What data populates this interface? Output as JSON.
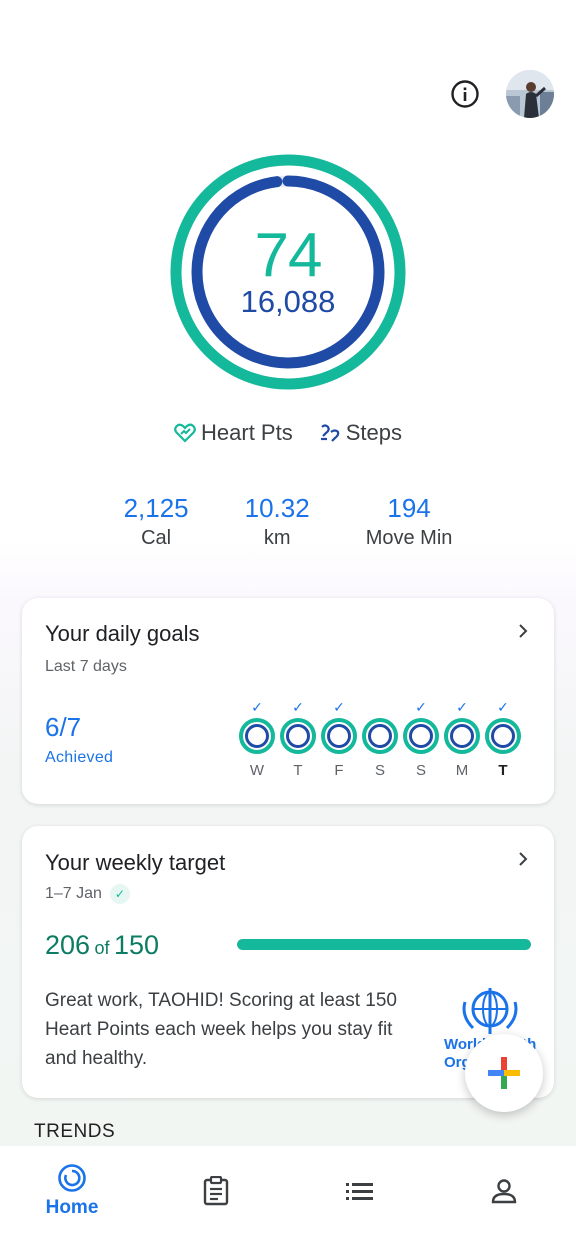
{
  "colors": {
    "heart_points": "#14b89a",
    "steps": "#1f4ba6",
    "accent": "#1a73e8"
  },
  "icons": {
    "info": "info-icon",
    "heart": "heart-points-icon",
    "steps": "steps-icon",
    "chevron": "chevron-right-icon",
    "fab": "add-icon"
  },
  "rings": {
    "heart_points": "74",
    "steps": "16,088",
    "heart_progress": 1.0,
    "steps_progress": 0.98
  },
  "legend": {
    "heart_label": "Heart Pts",
    "steps_label": "Steps"
  },
  "stats": [
    {
      "value": "2,125",
      "label": "Cal"
    },
    {
      "value": "10.32",
      "label": "km"
    },
    {
      "value": "194",
      "label": "Move Min"
    }
  ],
  "daily_goals": {
    "title": "Your daily goals",
    "subtitle": "Last 7 days",
    "achieved_value": "6/7",
    "achieved_label": "Achieved",
    "check_mark": "✓",
    "days": [
      {
        "label": "W",
        "checked": true
      },
      {
        "label": "T",
        "checked": true
      },
      {
        "label": "F",
        "checked": true
      },
      {
        "label": "S",
        "checked": false
      },
      {
        "label": "S",
        "checked": true
      },
      {
        "label": "M",
        "checked": true
      },
      {
        "label": "T",
        "checked": true,
        "today": true
      }
    ]
  },
  "weekly_target": {
    "title": "Your weekly target",
    "date_range": "1–7 Jan",
    "badge": "✓",
    "current": "206",
    "of_label": "of",
    "target": "150",
    "progress": 1.0,
    "message": "Great work, TAOHID! Scoring at least 150 Heart Points each week helps you stay fit and healthy.",
    "who_text": "World Health Organization"
  },
  "trends": {
    "heading": "TRENDS"
  },
  "nav": {
    "home_label": "Home"
  }
}
